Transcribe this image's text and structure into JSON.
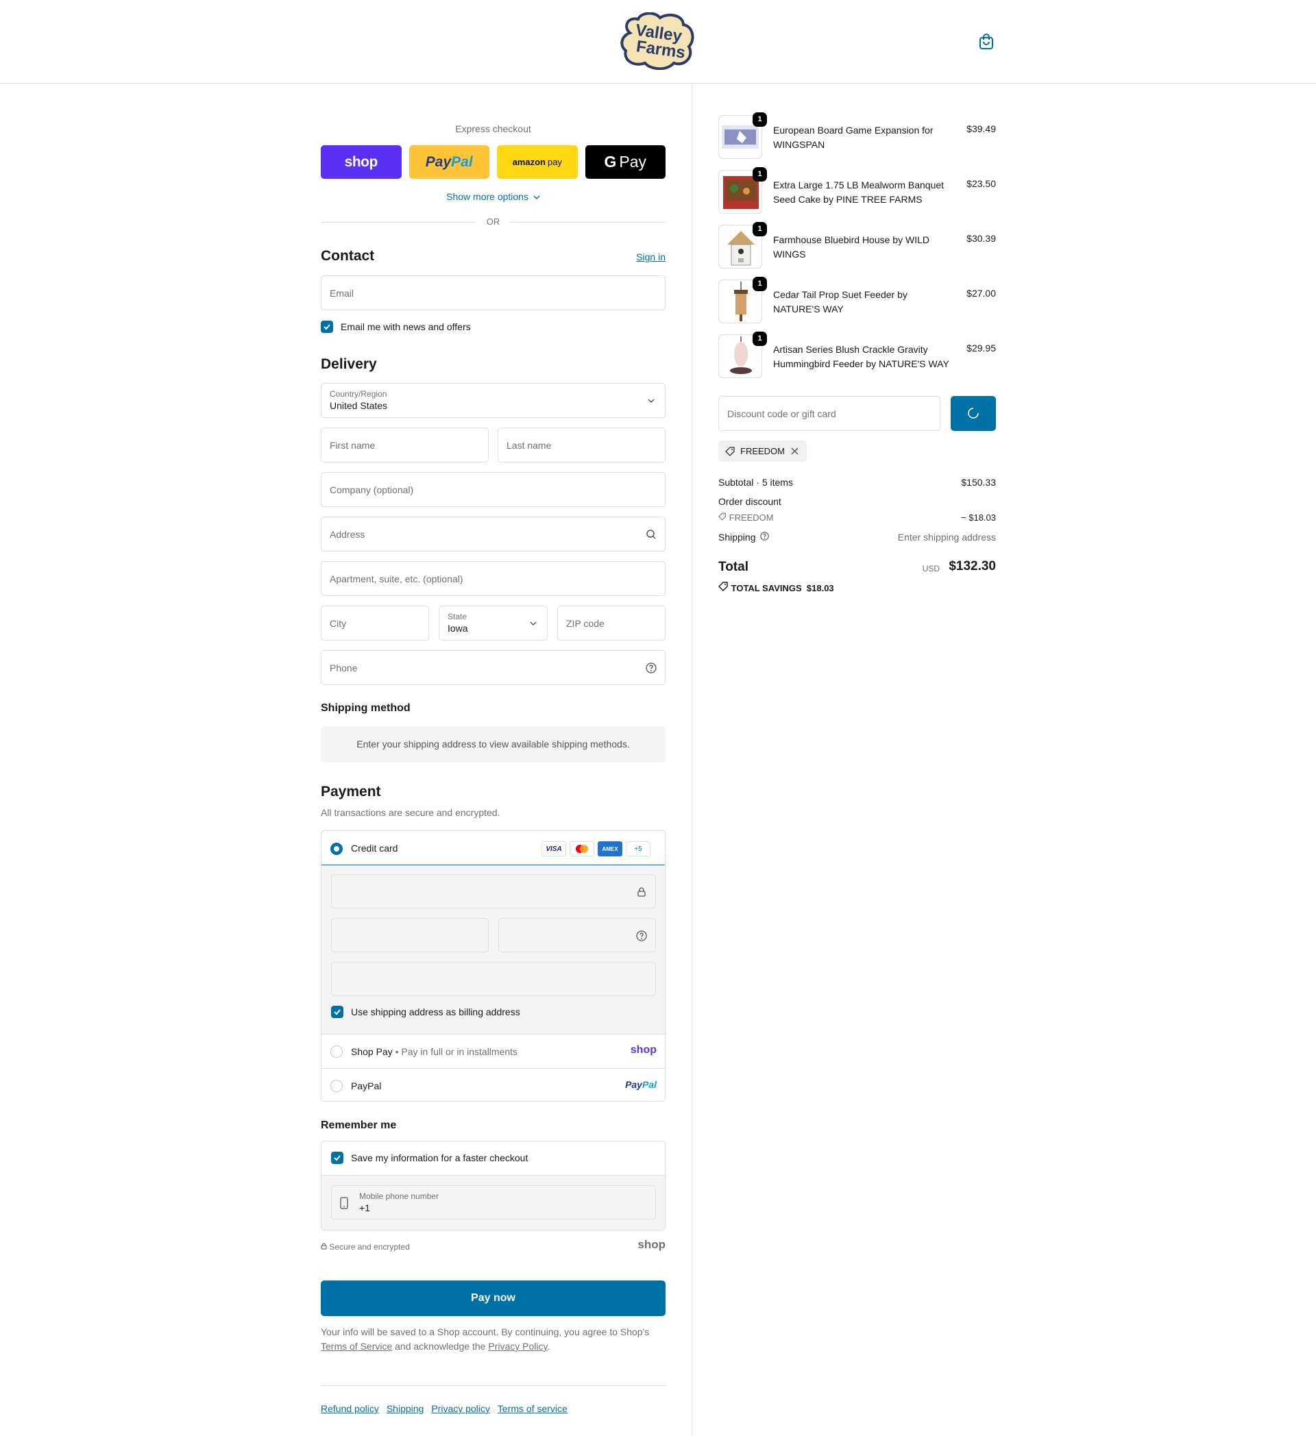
{
  "header": {
    "logo_line1": "Valley",
    "logo_line2": "Farms"
  },
  "express": {
    "label": "Express checkout",
    "shop": "shop",
    "paypal_a": "Pay",
    "paypal_b": "Pal",
    "amazon_a": "amazon",
    "amazon_b": "pay",
    "gpay_g": "G",
    "gpay_pay": "Pay",
    "show_more": "Show more options",
    "or": "OR"
  },
  "contact": {
    "title": "Contact",
    "sign_in": "Sign in",
    "email_placeholder": "Email",
    "news_label": "Email me with news and offers"
  },
  "delivery": {
    "title": "Delivery",
    "country_label": "Country/Region",
    "country_value": "United States",
    "first_name": "First name",
    "last_name": "Last name",
    "company": "Company (optional)",
    "address": "Address",
    "apartment": "Apartment, suite, etc. (optional)",
    "city": "City",
    "state_label": "State",
    "state_value": "Iowa",
    "zip": "ZIP code",
    "phone": "Phone"
  },
  "shipping_method": {
    "title": "Shipping method",
    "notice": "Enter your shipping address to view available shipping methods."
  },
  "payment": {
    "title": "Payment",
    "subtitle": "All transactions are secure and encrypted.",
    "credit_card": "Credit card",
    "card_visa": "VISA",
    "card_amex": "AMEX",
    "card_more": "+5",
    "billing_same": "Use shipping address as billing address",
    "shop_pay": "Shop Pay",
    "shop_pay_sub": "Pay in full or in installments",
    "shop_pay_logo": "shop",
    "paypal": "PayPal",
    "paypal_logo_a": "Pay",
    "paypal_logo_b": "Pal"
  },
  "remember": {
    "title": "Remember me",
    "save_label": "Save my information for a faster checkout",
    "mobile_label": "Mobile phone number",
    "mobile_value": "+1",
    "secure": "Secure and encrypted",
    "shop_logo": "shop"
  },
  "pay_now": "Pay now",
  "legal": {
    "text1": "Your info will be saved to a Shop account. By continuing, you agree to Shop's ",
    "tos": "Terms of Service",
    "text2": " and acknowledge the ",
    "privacy": "Privacy Policy",
    "text3": "."
  },
  "footer": {
    "links": [
      "Refund policy",
      "Shipping",
      "Privacy policy",
      "Terms of service"
    ]
  },
  "cart": {
    "items": [
      {
        "qty": "1",
        "name": "European Board Game Expansion for WINGSPAN",
        "price": "$39.49"
      },
      {
        "qty": "1",
        "name": "Extra Large 1.75 LB Mealworm Banquet Seed Cake by PINE TREE FARMS",
        "price": "$23.50"
      },
      {
        "qty": "1",
        "name": "Farmhouse Bluebird House by WILD WINGS",
        "price": "$30.39"
      },
      {
        "qty": "1",
        "name": "Cedar Tail Prop Suet Feeder by NATURE'S WAY",
        "price": "$27.00"
      },
      {
        "qty": "1",
        "name": "Artisan Series Blush Crackle Gravity Hummingbird Feeder by NATURE'S WAY",
        "price": "$29.95"
      }
    ],
    "discount_placeholder": "Discount code or gift card",
    "applied_code": "FREEDOM",
    "subtotal_label": "Subtotal · 5 items",
    "subtotal_value": "$150.33",
    "order_discount_label": "Order discount",
    "discount_code": "FREEDOM",
    "discount_value": "− $18.03",
    "shipping_label": "Shipping",
    "shipping_value": "Enter shipping address",
    "total_label": "Total",
    "currency": "USD",
    "total_value": "$132.30",
    "savings": "TOTAL SAVINGS  $18.03"
  },
  "colors": {
    "accent": "#0071a4",
    "shop_purple": "#5a31f4",
    "paypal_yellow": "#ffc439",
    "amazon_yellow": "#ffd814"
  }
}
